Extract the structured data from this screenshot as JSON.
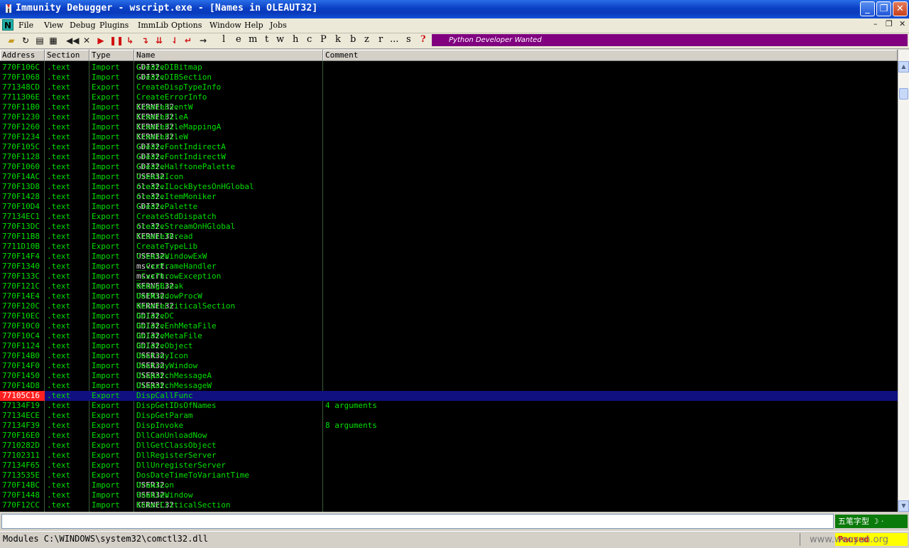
{
  "window": {
    "title": "Immunity Debugger - wscript.exe - [Names in OLEAUT32]"
  },
  "menu": {
    "items": [
      "File",
      "View",
      "Debug",
      "Plugins",
      "ImmLib",
      "Options",
      "Window",
      "Help",
      "Jobs"
    ]
  },
  "toolbar": {
    "letters": [
      "l",
      "e",
      "m",
      "t",
      "w",
      "h",
      "c",
      "P",
      "k",
      "b",
      "z",
      "r",
      "...",
      "s",
      "?"
    ],
    "banner": "Python Developer Wanted"
  },
  "columns": {
    "address": "Address",
    "section": "Section",
    "type": "Type",
    "name": "Name",
    "comment": "Comment"
  },
  "rows": [
    {
      "address": "770F106C",
      "section": ".text",
      "type": "Import",
      "lib": "GDI32.",
      "func": "CreateDIBitmap",
      "comment": ""
    },
    {
      "address": "770F1068",
      "section": ".text",
      "type": "Import",
      "lib": "GDI32.",
      "func": "CreateDIBSection",
      "comment": ""
    },
    {
      "address": "771348CD",
      "section": ".text",
      "type": "Export",
      "lib": "",
      "func": "CreateDispTypeInfo",
      "comment": ""
    },
    {
      "address": "7711306E",
      "section": ".text",
      "type": "Export",
      "lib": "",
      "func": "CreateErrorInfo",
      "comment": ""
    },
    {
      "address": "770F11B0",
      "section": ".text",
      "type": "Import",
      "lib": "KERNEL32.",
      "func": "CreateEventW",
      "comment": ""
    },
    {
      "address": "770F1230",
      "section": ".text",
      "type": "Import",
      "lib": "KERNEL32.",
      "func": "CreateFileA",
      "comment": ""
    },
    {
      "address": "770F1260",
      "section": ".text",
      "type": "Import",
      "lib": "KERNEL32.",
      "func": "CreateFileMappingA",
      "comment": ""
    },
    {
      "address": "770F1234",
      "section": ".text",
      "type": "Import",
      "lib": "KERNEL32.",
      "func": "CreateFileW",
      "comment": ""
    },
    {
      "address": "770F105C",
      "section": ".text",
      "type": "Import",
      "lib": "GDI32.",
      "func": "CreateFontIndirectA",
      "comment": ""
    },
    {
      "address": "770F1128",
      "section": ".text",
      "type": "Import",
      "lib": "GDI32.",
      "func": "CreateFontIndirectW",
      "comment": ""
    },
    {
      "address": "770F1060",
      "section": ".text",
      "type": "Import",
      "lib": "GDI32.",
      "func": "CreateHalftonePalette",
      "comment": ""
    },
    {
      "address": "770F14AC",
      "section": ".text",
      "type": "Import",
      "lib": "USER32.",
      "func": "CreateIcon",
      "comment": ""
    },
    {
      "address": "770F13D8",
      "section": ".text",
      "type": "Import",
      "lib": "ole32.",
      "func": "CreateILockBytesOnHGlobal",
      "comment": ""
    },
    {
      "address": "770F1428",
      "section": ".text",
      "type": "Import",
      "lib": "ole32.",
      "func": "CreateItemMoniker",
      "comment": ""
    },
    {
      "address": "770F10D4",
      "section": ".text",
      "type": "Import",
      "lib": "GDI32.",
      "func": "CreatePalette",
      "comment": ""
    },
    {
      "address": "77134EC1",
      "section": ".text",
      "type": "Export",
      "lib": "",
      "func": "CreateStdDispatch",
      "comment": ""
    },
    {
      "address": "770F13DC",
      "section": ".text",
      "type": "Import",
      "lib": "ole32.",
      "func": "CreateStreamOnHGlobal",
      "comment": ""
    },
    {
      "address": "770F11B8",
      "section": ".text",
      "type": "Import",
      "lib": "KERNEL32.",
      "func": "CreateThread",
      "comment": ""
    },
    {
      "address": "7711D10B",
      "section": ".text",
      "type": "Export",
      "lib": "",
      "func": "CreateTypeLib",
      "comment": ""
    },
    {
      "address": "770F14F4",
      "section": ".text",
      "type": "Import",
      "lib": "USER32.",
      "func": "CreateWindowExW",
      "comment": ""
    },
    {
      "address": "770F1340",
      "section": ".text",
      "type": "Import",
      "lib": "msvcrt.",
      "func": "__CxxFrameHandler",
      "comment": ""
    },
    {
      "address": "770F133C",
      "section": ".text",
      "type": "Import",
      "lib": "msvcrt.",
      "func": "_CxxThrowException",
      "comment": ""
    },
    {
      "address": "770F121C",
      "section": ".text",
      "type": "Import",
      "lib": "KERNEL32.",
      "func": "DebugBreak",
      "comment": ""
    },
    {
      "address": "770F14E4",
      "section": ".text",
      "type": "Import",
      "lib": "USER32.",
      "func": "DefWindowProcW",
      "comment": ""
    },
    {
      "address": "770F120C",
      "section": ".text",
      "type": "Import",
      "lib": "KERNEL32.",
      "func": "DeleteCriticalSection",
      "comment": ""
    },
    {
      "address": "770F10EC",
      "section": ".text",
      "type": "Import",
      "lib": "GDI32.",
      "func": "DeleteDC",
      "comment": ""
    },
    {
      "address": "770F10C0",
      "section": ".text",
      "type": "Import",
      "lib": "GDI32.",
      "func": "DeleteEnhMetaFile",
      "comment": ""
    },
    {
      "address": "770F10C4",
      "section": ".text",
      "type": "Import",
      "lib": "GDI32.",
      "func": "DeleteMetaFile",
      "comment": ""
    },
    {
      "address": "770F1124",
      "section": ".text",
      "type": "Import",
      "lib": "GDI32.",
      "func": "DeleteObject",
      "comment": ""
    },
    {
      "address": "770F14B0",
      "section": ".text",
      "type": "Import",
      "lib": "USER32.",
      "func": "DestroyIcon",
      "comment": ""
    },
    {
      "address": "770F14F0",
      "section": ".text",
      "type": "Import",
      "lib": "USER32.",
      "func": "DestroyWindow",
      "comment": ""
    },
    {
      "address": "770F1450",
      "section": ".text",
      "type": "Import",
      "lib": "USER32.",
      "func": "DispatchMessageA",
      "comment": ""
    },
    {
      "address": "770F14D8",
      "section": ".text",
      "type": "Import",
      "lib": "USER32.",
      "func": "DispatchMessageW",
      "comment": ""
    },
    {
      "address": "77105C16",
      "section": ".text",
      "type": "Export",
      "lib": "",
      "func": "DispCallFunc",
      "comment": "",
      "selected": true
    },
    {
      "address": "77134F19",
      "section": ".text",
      "type": "Export",
      "lib": "",
      "func": "DispGetIDsOfNames",
      "comment": "4 arguments"
    },
    {
      "address": "77134ECE",
      "section": ".text",
      "type": "Export",
      "lib": "",
      "func": "DispGetParam",
      "comment": ""
    },
    {
      "address": "77134F39",
      "section": ".text",
      "type": "Export",
      "lib": "",
      "func": "DispInvoke",
      "comment": "8 arguments"
    },
    {
      "address": "770F16E0",
      "section": ".text",
      "type": "Export",
      "lib": "",
      "func": "DllCanUnloadNow",
      "comment": ""
    },
    {
      "address": "7710282D",
      "section": ".text",
      "type": "Export",
      "lib": "",
      "func": "DllGetClassObject",
      "comment": ""
    },
    {
      "address": "77102311",
      "section": ".text",
      "type": "Export",
      "lib": "",
      "func": "DllRegisterServer",
      "comment": ""
    },
    {
      "address": "77134F65",
      "section": ".text",
      "type": "Export",
      "lib": "",
      "func": "DllUnregisterServer",
      "comment": ""
    },
    {
      "address": "7713535E",
      "section": ".text",
      "type": "Export",
      "lib": "",
      "func": "DosDateTimeToVariantTime",
      "comment": ""
    },
    {
      "address": "770F14BC",
      "section": ".text",
      "type": "Import",
      "lib": "USER32.",
      "func": "DrawIcon",
      "comment": ""
    },
    {
      "address": "770F1448",
      "section": ".text",
      "type": "Import",
      "lib": "USER32.",
      "func": "EnableWindow",
      "comment": ""
    },
    {
      "address": "770F12CC",
      "section": ".text",
      "type": "Import",
      "lib": "KERNEL32.",
      "func": "EnterCriticalSection",
      "comment": ""
    }
  ],
  "status": {
    "text": "Modules C:\\WINDOWS\\system32\\comctl32.dll",
    "state": "Paused",
    "ime": "五笔字型"
  },
  "watermark": "www.wooyun.org",
  "colors": {
    "list_bg": "#000000",
    "text_green": "#00e000",
    "selection": "#101080",
    "selected_address": "#ff2020",
    "banner": "#800080"
  }
}
